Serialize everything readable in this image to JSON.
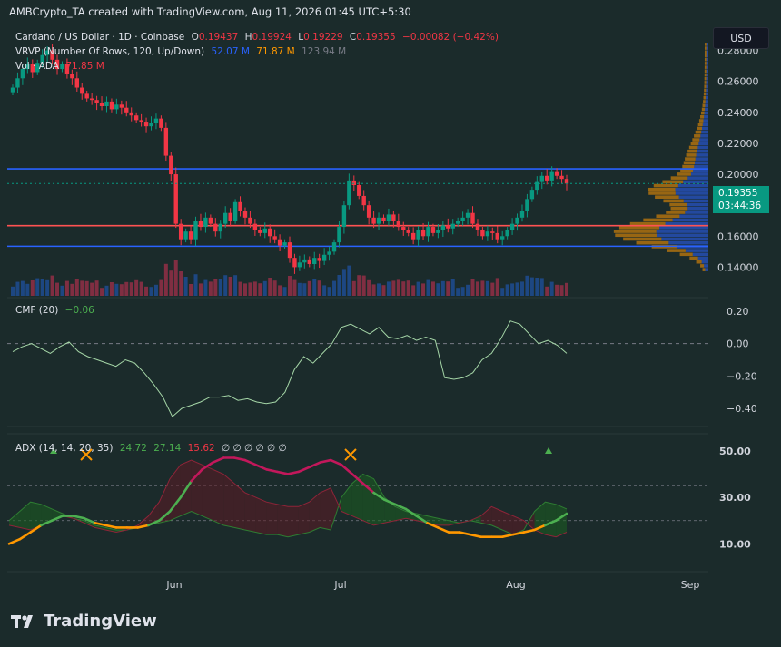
{
  "header": {
    "text": "AMBCrypto_TA created with TradingView.com, Aug 11, 2026 01:45 UTC+5:30"
  },
  "legend": {
    "symbol": "Cardano / US Dollar · 1D · Coinbase",
    "open_label": "O",
    "open": "0.19437",
    "high_label": "H",
    "high": "0.19924",
    "low_label": "L",
    "low": "0.19229",
    "close_label": "C",
    "close": "0.19355",
    "change": "−0.00082 (−0.42%)",
    "vrvp_label": "VRVP (Number Of Rows, 120, Up/Down)",
    "vrvp_up": "52.07 M",
    "vrvp_down": "71.87 M",
    "vrvp_total": "123.94 M",
    "vol_label": "Vol · ADA",
    "vol_value": "71.85 M",
    "cmf_label": "CMF (20)",
    "cmf_value": "−0.06",
    "adx_label": "ADX (14, 14, 20, 35)",
    "adx_v1": "24.72",
    "adx_v2": "27.14",
    "adx_v3": "15.62",
    "adx_empty": "∅ ∅ ∅ ∅ ∅ ∅"
  },
  "currency_button": "USD",
  "last_price": {
    "value": "0.19355",
    "countdown": "03:44:36"
  },
  "logo_text": "TradingView",
  "colors": {
    "up": "#089981",
    "down": "#f23645",
    "bg": "#1b2b2b",
    "hline_blue": "#2962ff",
    "hline_red": "#f23645",
    "vrvp_up": "#2962ff",
    "vrvp_down": "#ff9800",
    "cmf_line": "#a5d6a7",
    "adx_orange": "#ff9800",
    "adx_red": "#c2185b",
    "adx_green": "#4caf50"
  },
  "chart_data": [
    {
      "type": "candlestick",
      "name": "Cardano / US Dollar · 1D · Coinbase",
      "x_ticks": [
        "Jun",
        "Jul",
        "Aug",
        "Sep"
      ],
      "ylim": [
        0.125,
        0.295
      ],
      "y_ticks": [
        "0.28000",
        "0.26000",
        "0.24000",
        "0.22000",
        "0.20000",
        "0.18000",
        "0.16000",
        "0.14000"
      ],
      "horizontal_lines": [
        {
          "value": 0.2035,
          "color": "blue"
        },
        {
          "value": 0.1668,
          "color": "red"
        },
        {
          "value": 0.1535,
          "color": "blue"
        }
      ],
      "close": [
        0.256,
        0.262,
        0.268,
        0.271,
        0.266,
        0.272,
        0.277,
        0.28,
        0.274,
        0.268,
        0.271,
        0.265,
        0.262,
        0.256,
        0.252,
        0.249,
        0.248,
        0.246,
        0.244,
        0.247,
        0.242,
        0.245,
        0.243,
        0.24,
        0.238,
        0.235,
        0.234,
        0.231,
        0.233,
        0.236,
        0.23,
        0.212,
        0.2,
        0.168,
        0.158,
        0.163,
        0.158,
        0.17,
        0.166,
        0.172,
        0.168,
        0.163,
        0.168,
        0.175,
        0.17,
        0.182,
        0.176,
        0.172,
        0.168,
        0.164,
        0.162,
        0.165,
        0.16,
        0.158,
        0.154,
        0.156,
        0.146,
        0.14,
        0.143,
        0.145,
        0.142,
        0.146,
        0.144,
        0.148,
        0.15,
        0.156,
        0.166,
        0.18,
        0.196,
        0.193,
        0.186,
        0.18,
        0.172,
        0.168,
        0.172,
        0.17,
        0.174,
        0.17,
        0.166,
        0.164,
        0.162,
        0.158,
        0.164,
        0.16,
        0.166,
        0.162,
        0.164,
        0.167,
        0.165,
        0.168,
        0.17,
        0.172,
        0.175,
        0.168,
        0.164,
        0.16,
        0.163,
        0.162,
        0.158,
        0.16,
        0.164,
        0.168,
        0.172,
        0.176,
        0.184,
        0.19,
        0.195,
        0.199,
        0.196,
        0.202,
        0.199,
        0.197,
        0.194
      ],
      "series_open_close_shown": [
        "0.19437",
        "0.19355"
      ]
    },
    {
      "type": "line",
      "name": "CMF (20)",
      "ylim": [
        -0.5,
        0.25
      ],
      "y_ticks": [
        "0.20",
        "0.00",
        "−0.20",
        "−0.40"
      ],
      "values": [
        -0.05,
        -0.02,
        0.0,
        -0.03,
        -0.06,
        -0.02,
        0.01,
        -0.05,
        -0.08,
        -0.1,
        -0.12,
        -0.14,
        -0.1,
        -0.12,
        -0.18,
        -0.25,
        -0.33,
        -0.45,
        -0.4,
        -0.38,
        -0.36,
        -0.33,
        -0.33,
        -0.32,
        -0.35,
        -0.34,
        -0.36,
        -0.37,
        -0.36,
        -0.3,
        -0.16,
        -0.08,
        -0.12,
        -0.06,
        0.0,
        0.1,
        0.12,
        0.09,
        0.06,
        0.1,
        0.04,
        0.03,
        0.05,
        0.02,
        0.04,
        0.02,
        -0.21,
        -0.22,
        -0.21,
        -0.18,
        -0.1,
        -0.06,
        0.03,
        0.14,
        0.12,
        0.06,
        0.0,
        0.02,
        -0.01,
        -0.06
      ]
    },
    {
      "type": "line",
      "name": "ADX (14, 14, 20, 35)",
      "ylim": [
        0,
        55
      ],
      "y_ticks": [
        "50.00",
        "30.00",
        "10.00"
      ],
      "reference_levels": [
        20,
        35
      ],
      "adx": [
        10,
        12,
        15,
        18,
        20,
        22,
        22,
        21,
        19,
        18,
        17,
        17,
        17,
        18,
        20,
        24,
        30,
        37,
        42,
        45,
        47,
        47,
        46,
        44,
        42,
        41,
        40,
        41,
        43,
        45,
        46,
        44,
        40,
        36,
        32,
        29,
        27,
        25,
        22,
        19,
        17,
        15,
        15,
        14,
        13,
        13,
        13,
        14,
        15,
        16,
        18,
        20,
        23
      ],
      "plus_di": [
        20,
        24,
        28,
        27,
        25,
        23,
        21,
        20,
        18,
        17,
        16,
        16,
        17,
        18,
        19,
        20,
        22,
        24,
        22,
        20,
        18,
        17,
        16,
        15,
        14,
        14,
        13,
        14,
        15,
        17,
        16,
        30,
        36,
        40,
        38,
        30,
        26,
        24,
        23,
        22,
        21,
        20,
        19,
        20,
        19,
        18,
        16,
        14,
        16,
        24,
        28,
        27,
        25
      ],
      "minus_di": [
        18,
        17,
        16,
        18,
        20,
        22,
        21,
        19,
        17,
        16,
        15,
        16,
        18,
        22,
        28,
        38,
        44,
        46,
        44,
        42,
        40,
        36,
        32,
        30,
        28,
        27,
        26,
        26,
        28,
        32,
        34,
        24,
        22,
        20,
        18,
        19,
        20,
        21,
        20,
        19,
        18,
        18,
        19,
        20,
        22,
        26,
        24,
        22,
        20,
        16,
        14,
        13,
        15
      ]
    }
  ]
}
